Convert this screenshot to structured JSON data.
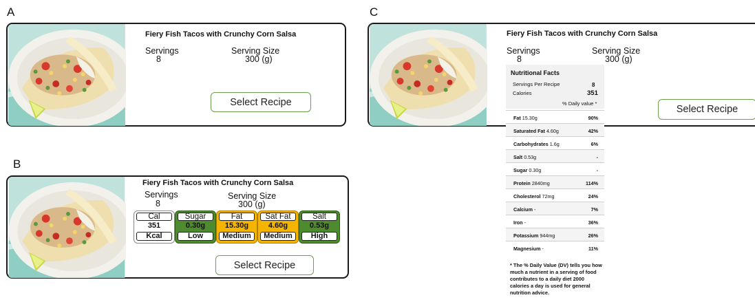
{
  "recipe": {
    "title": "Fiery Fish Tacos with Crunchy Corn Salsa",
    "servings_label": "Servings",
    "servings_value": "8",
    "size_label": "Serving Size",
    "size_value": "300 (g)",
    "select_label": "Select Recipe"
  },
  "panels": {
    "a": "A",
    "b": "B",
    "c": "C"
  },
  "traffic_lights": [
    {
      "name": "Cal",
      "value": "351",
      "level": "Kcal",
      "color": "#ffffff"
    },
    {
      "name": "Sugar",
      "value": "0.30g",
      "level": "Low",
      "color": "#4e8a2e"
    },
    {
      "name": "Fat",
      "value": "15.30g",
      "level": "Medium",
      "color": "#f5b400"
    },
    {
      "name": "Sat Fat",
      "value": "4.60g",
      "level": "Medium",
      "color": "#f5b400"
    },
    {
      "name": "Salt",
      "value": "0.53g",
      "level": "High",
      "color": "#4e8a2e"
    }
  ],
  "nutrition": {
    "heading": "Nutritional Facts",
    "servings_per_recipe_label": "Servings Per Recipe",
    "servings_per_recipe_value": "8",
    "calories_label": "Calories",
    "calories_value": "351",
    "daily_value_label": "% Daily value *",
    "rows": [
      {
        "name": "Fat",
        "amount": "15.30g",
        "pct": "90%"
      },
      {
        "name": "Saturated Fat",
        "amount": "4.60g",
        "pct": "42%"
      },
      {
        "name": "Carbohydrates",
        "amount": "1.6g",
        "pct": "6%"
      },
      {
        "name": "Salt",
        "amount": "0.53g",
        "pct": "-"
      },
      {
        "name": "Sugar",
        "amount": "0.30g",
        "pct": "-"
      },
      {
        "name": "Protein",
        "amount": "2840mg",
        "pct": "114%"
      },
      {
        "name": "Cholesterol",
        "amount": "72mg",
        "pct": "24%"
      },
      {
        "name": "Calcium",
        "amount": "-",
        "pct": "7%"
      },
      {
        "name": "Iron",
        "amount": "-",
        "pct": "36%"
      },
      {
        "name": "Potassium",
        "amount": "944mg",
        "pct": "26%"
      },
      {
        "name": "Magnesium",
        "amount": "-",
        "pct": "11%"
      }
    ],
    "footnote": "* The % Daily Value (DV) tells you how much a nutrient in a serving of food contributes to a daily diet 2000 calories a day is used for general nutrition advice."
  }
}
